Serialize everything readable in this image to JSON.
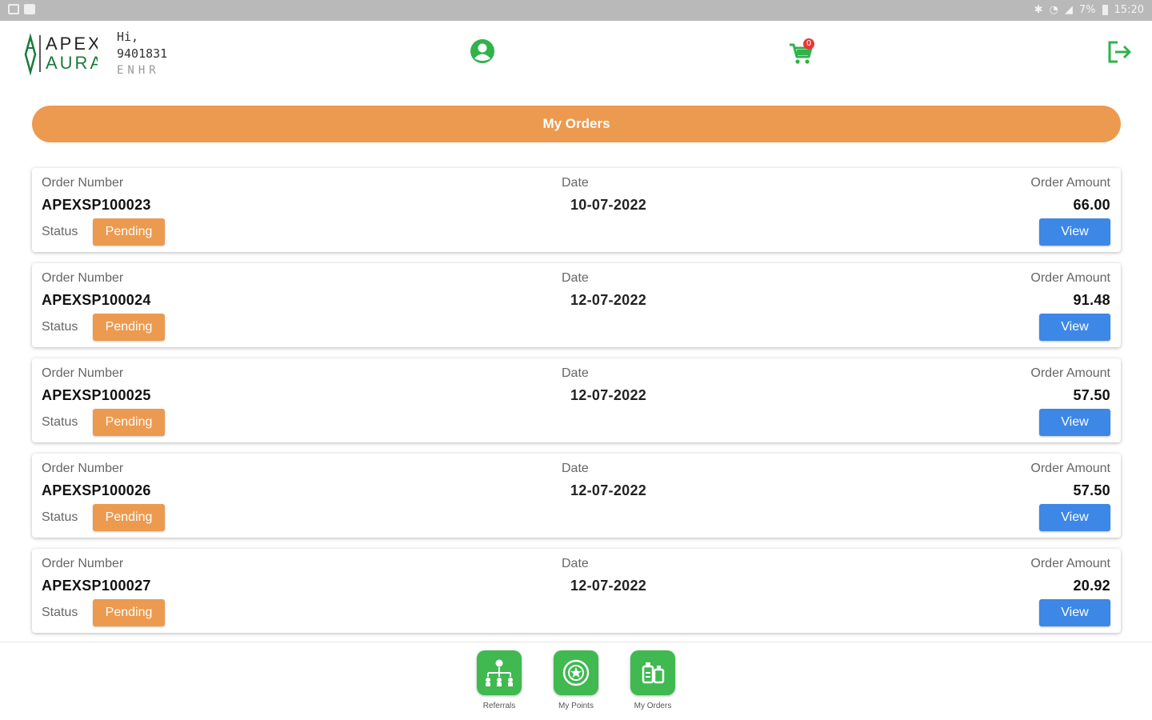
{
  "status_bar": {
    "icons_left": [
      "gallery-icon",
      "message-icon"
    ],
    "battery": "7%",
    "time": "15:20"
  },
  "header": {
    "logo": {
      "line1": "APEX",
      "line2": "AURA"
    },
    "greeting": "Hi,",
    "user_id": "9401831",
    "user_code": "ENHR",
    "cart_count": "0",
    "colors": {
      "icon_green": "#2fb34a"
    }
  },
  "page_title": "My Orders",
  "labels": {
    "order_number": "Order Number",
    "date": "Date",
    "order_amount": "Order Amount",
    "status": "Status",
    "view": "View"
  },
  "orders": [
    {
      "number": "APEXSP100023",
      "date": "10-07-2022",
      "amount": "66.00",
      "status": "Pending"
    },
    {
      "number": "APEXSP100024",
      "date": "12-07-2022",
      "amount": "91.48",
      "status": "Pending"
    },
    {
      "number": "APEXSP100025",
      "date": "12-07-2022",
      "amount": "57.50",
      "status": "Pending"
    },
    {
      "number": "APEXSP100026",
      "date": "12-07-2022",
      "amount": "57.50",
      "status": "Pending"
    },
    {
      "number": "APEXSP100027",
      "date": "12-07-2022",
      "amount": "20.92",
      "status": "Pending"
    }
  ],
  "bottom_nav": [
    {
      "label": "Referrals",
      "icon": "referrals-icon"
    },
    {
      "label": "My Points",
      "icon": "points-icon"
    },
    {
      "label": "My Orders",
      "icon": "orders-icon"
    }
  ],
  "colors": {
    "accent_orange": "#ec9a4f",
    "view_blue": "#3d87e6",
    "nav_green": "#3fb950"
  }
}
